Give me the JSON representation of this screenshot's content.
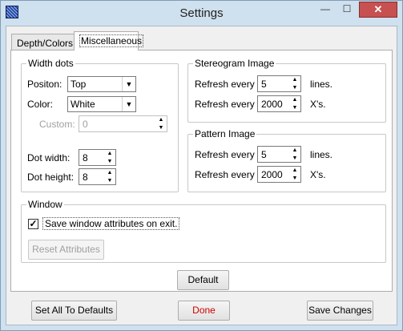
{
  "window": {
    "title": "Settings",
    "icon": "app-icon",
    "controls": {
      "minimize": "—",
      "maximize": "☐",
      "close": "✕"
    }
  },
  "tabs": [
    {
      "label": "Depth/Colors",
      "selected": false
    },
    {
      "label": "Miscellaneous",
      "selected": true
    }
  ],
  "width_dots": {
    "group_label": "Width dots",
    "position_label": "Positon:",
    "position_value": "Top",
    "color_label": "Color:",
    "color_value": "White",
    "custom_label": "Custom:",
    "custom_value": "0",
    "dot_width_label": "Dot width:",
    "dot_width_value": "8",
    "dot_height_label": "Dot height:",
    "dot_height_value": "8"
  },
  "stereogram_image": {
    "group_label": "Stereogram Image",
    "refresh1_label": "Refresh every",
    "refresh1_value": "5",
    "refresh1_unit": "lines.",
    "refresh2_label": "Refresh every",
    "refresh2_value": "2000",
    "refresh2_unit": "X's."
  },
  "pattern_image": {
    "group_label": "Pattern Image",
    "refresh1_label": "Refresh every",
    "refresh1_value": "5",
    "refresh1_unit": "lines.",
    "refresh2_label": "Refresh every",
    "refresh2_value": "2000",
    "refresh2_unit": "X's."
  },
  "window_group": {
    "group_label": "Window",
    "save_attributes_label": "Save window attributes on exit.",
    "save_attributes_checked": true,
    "reset_button": "Reset Attributes"
  },
  "buttons": {
    "default": "Default",
    "set_all_defaults": "Set All To Defaults",
    "done": "Done",
    "save_changes": "Save Changes"
  },
  "colors": {
    "frame": "#cfe0ee",
    "close_button": "#c75050",
    "done_text": "#d00000"
  }
}
